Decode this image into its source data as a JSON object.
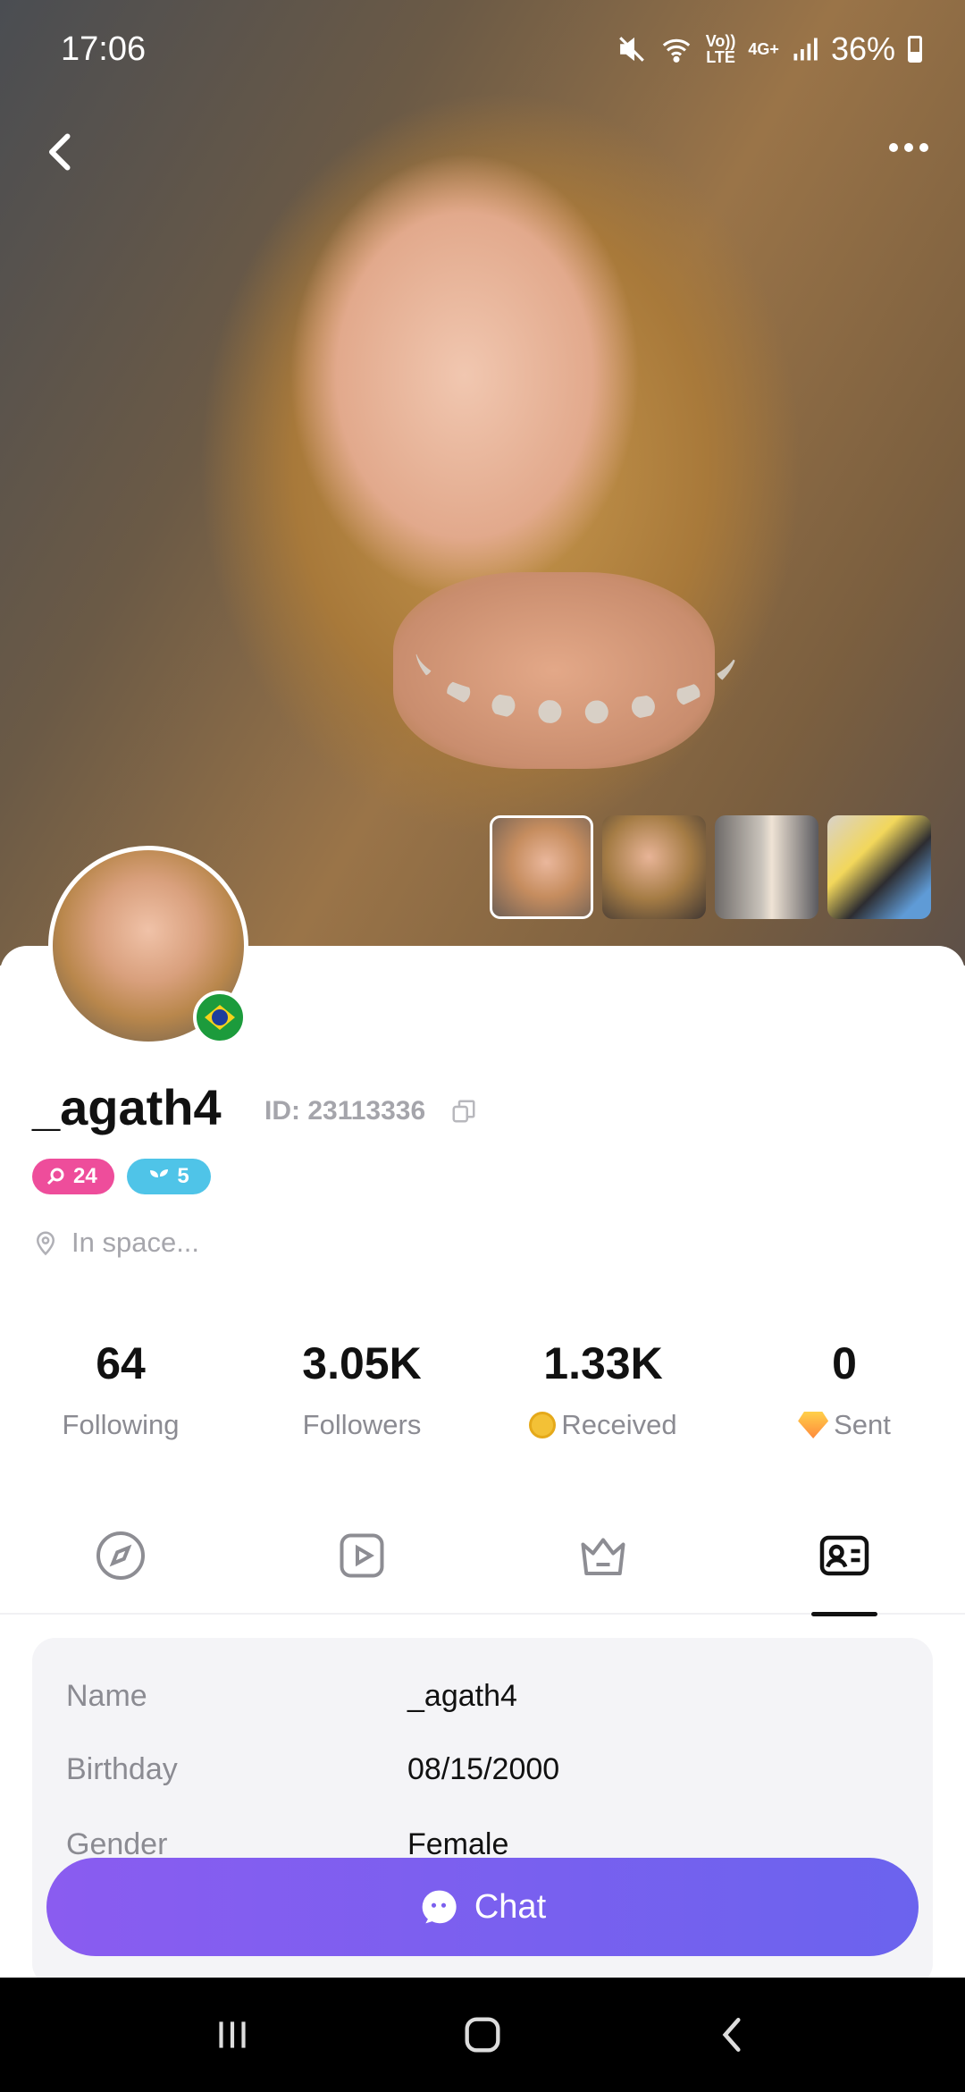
{
  "status_bar": {
    "time": "17:06",
    "volte": "Vo))",
    "lte": "LTE",
    "net": "4G+",
    "battery": "36%"
  },
  "profile": {
    "username": "_agath4",
    "id_text": "ID: 23113336",
    "level_badge": "24",
    "charm_badge": "5",
    "location": "In space...",
    "country_flag": "brazil-flag"
  },
  "stats": [
    {
      "value": "64",
      "label": "Following"
    },
    {
      "value": "3.05K",
      "label": "Followers"
    },
    {
      "value": "1.33K",
      "label": "Received",
      "icon": "coin-icon"
    },
    {
      "value": "0",
      "label": "Sent",
      "icon": "gem-icon"
    }
  ],
  "tabs": [
    {
      "icon": "compass-icon",
      "active": false
    },
    {
      "icon": "video-play-icon",
      "active": false
    },
    {
      "icon": "crown-icon",
      "active": false
    },
    {
      "icon": "profile-card-icon",
      "active": true
    }
  ],
  "info": [
    {
      "key": "Name",
      "value": "_agath4"
    },
    {
      "key": "Birthday",
      "value": "08/15/2000"
    },
    {
      "key": "Gender",
      "value": "Female"
    }
  ],
  "chat_button": {
    "label": "Chat"
  },
  "colors": {
    "accent_start": "#8a5cf0",
    "accent_end": "#6b63ee",
    "level_badge": "#ee4d9b",
    "charm_badge": "#4fc4e8"
  }
}
